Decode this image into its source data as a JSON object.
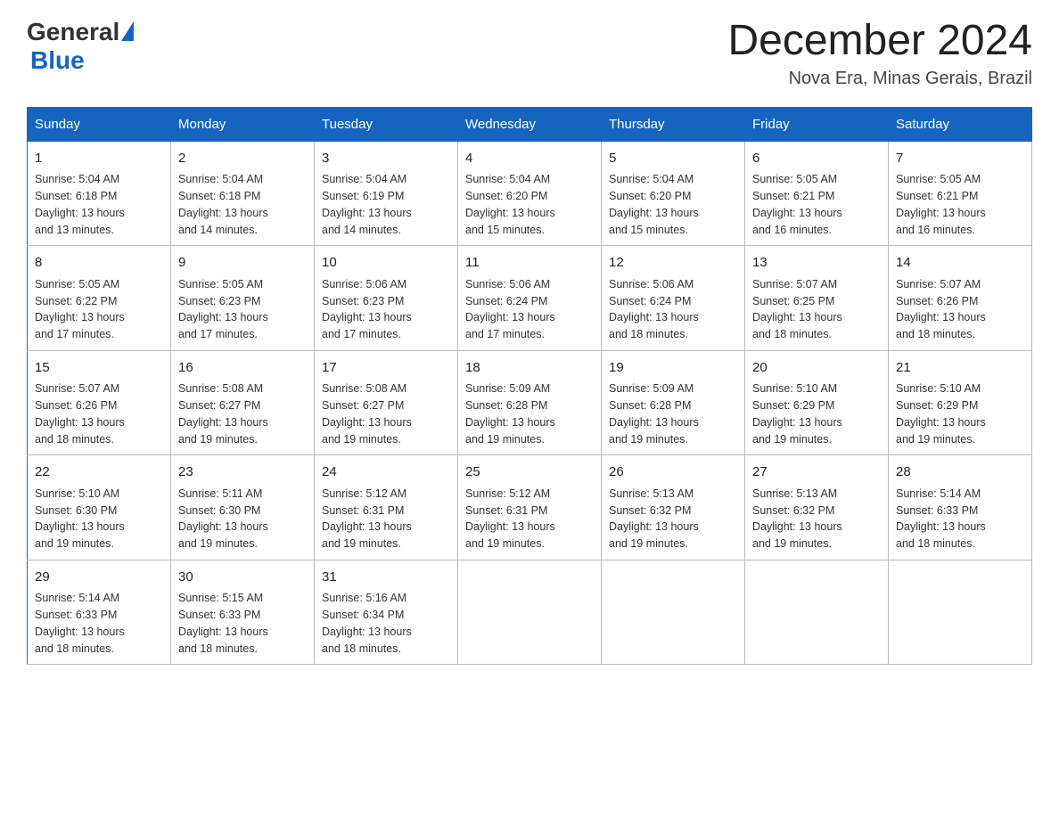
{
  "header": {
    "logo": {
      "text_general": "General",
      "text_blue": "Blue"
    },
    "title": "December 2024",
    "subtitle": "Nova Era, Minas Gerais, Brazil"
  },
  "weekdays": [
    "Sunday",
    "Monday",
    "Tuesday",
    "Wednesday",
    "Thursday",
    "Friday",
    "Saturday"
  ],
  "weeks": [
    [
      {
        "day": "1",
        "sunrise": "5:04 AM",
        "sunset": "6:18 PM",
        "daylight": "13 hours and 13 minutes."
      },
      {
        "day": "2",
        "sunrise": "5:04 AM",
        "sunset": "6:18 PM",
        "daylight": "13 hours and 14 minutes."
      },
      {
        "day": "3",
        "sunrise": "5:04 AM",
        "sunset": "6:19 PM",
        "daylight": "13 hours and 14 minutes."
      },
      {
        "day": "4",
        "sunrise": "5:04 AM",
        "sunset": "6:20 PM",
        "daylight": "13 hours and 15 minutes."
      },
      {
        "day": "5",
        "sunrise": "5:04 AM",
        "sunset": "6:20 PM",
        "daylight": "13 hours and 15 minutes."
      },
      {
        "day": "6",
        "sunrise": "5:05 AM",
        "sunset": "6:21 PM",
        "daylight": "13 hours and 16 minutes."
      },
      {
        "day": "7",
        "sunrise": "5:05 AM",
        "sunset": "6:21 PM",
        "daylight": "13 hours and 16 minutes."
      }
    ],
    [
      {
        "day": "8",
        "sunrise": "5:05 AM",
        "sunset": "6:22 PM",
        "daylight": "13 hours and 17 minutes."
      },
      {
        "day": "9",
        "sunrise": "5:05 AM",
        "sunset": "6:23 PM",
        "daylight": "13 hours and 17 minutes."
      },
      {
        "day": "10",
        "sunrise": "5:06 AM",
        "sunset": "6:23 PM",
        "daylight": "13 hours and 17 minutes."
      },
      {
        "day": "11",
        "sunrise": "5:06 AM",
        "sunset": "6:24 PM",
        "daylight": "13 hours and 17 minutes."
      },
      {
        "day": "12",
        "sunrise": "5:06 AM",
        "sunset": "6:24 PM",
        "daylight": "13 hours and 18 minutes."
      },
      {
        "day": "13",
        "sunrise": "5:07 AM",
        "sunset": "6:25 PM",
        "daylight": "13 hours and 18 minutes."
      },
      {
        "day": "14",
        "sunrise": "5:07 AM",
        "sunset": "6:26 PM",
        "daylight": "13 hours and 18 minutes."
      }
    ],
    [
      {
        "day": "15",
        "sunrise": "5:07 AM",
        "sunset": "6:26 PM",
        "daylight": "13 hours and 18 minutes."
      },
      {
        "day": "16",
        "sunrise": "5:08 AM",
        "sunset": "6:27 PM",
        "daylight": "13 hours and 19 minutes."
      },
      {
        "day": "17",
        "sunrise": "5:08 AM",
        "sunset": "6:27 PM",
        "daylight": "13 hours and 19 minutes."
      },
      {
        "day": "18",
        "sunrise": "5:09 AM",
        "sunset": "6:28 PM",
        "daylight": "13 hours and 19 minutes."
      },
      {
        "day": "19",
        "sunrise": "5:09 AM",
        "sunset": "6:28 PM",
        "daylight": "13 hours and 19 minutes."
      },
      {
        "day": "20",
        "sunrise": "5:10 AM",
        "sunset": "6:29 PM",
        "daylight": "13 hours and 19 minutes."
      },
      {
        "day": "21",
        "sunrise": "5:10 AM",
        "sunset": "6:29 PM",
        "daylight": "13 hours and 19 minutes."
      }
    ],
    [
      {
        "day": "22",
        "sunrise": "5:10 AM",
        "sunset": "6:30 PM",
        "daylight": "13 hours and 19 minutes."
      },
      {
        "day": "23",
        "sunrise": "5:11 AM",
        "sunset": "6:30 PM",
        "daylight": "13 hours and 19 minutes."
      },
      {
        "day": "24",
        "sunrise": "5:12 AM",
        "sunset": "6:31 PM",
        "daylight": "13 hours and 19 minutes."
      },
      {
        "day": "25",
        "sunrise": "5:12 AM",
        "sunset": "6:31 PM",
        "daylight": "13 hours and 19 minutes."
      },
      {
        "day": "26",
        "sunrise": "5:13 AM",
        "sunset": "6:32 PM",
        "daylight": "13 hours and 19 minutes."
      },
      {
        "day": "27",
        "sunrise": "5:13 AM",
        "sunset": "6:32 PM",
        "daylight": "13 hours and 19 minutes."
      },
      {
        "day": "28",
        "sunrise": "5:14 AM",
        "sunset": "6:33 PM",
        "daylight": "13 hours and 18 minutes."
      }
    ],
    [
      {
        "day": "29",
        "sunrise": "5:14 AM",
        "sunset": "6:33 PM",
        "daylight": "13 hours and 18 minutes."
      },
      {
        "day": "30",
        "sunrise": "5:15 AM",
        "sunset": "6:33 PM",
        "daylight": "13 hours and 18 minutes."
      },
      {
        "day": "31",
        "sunrise": "5:16 AM",
        "sunset": "6:34 PM",
        "daylight": "13 hours and 18 minutes."
      },
      null,
      null,
      null,
      null
    ]
  ]
}
